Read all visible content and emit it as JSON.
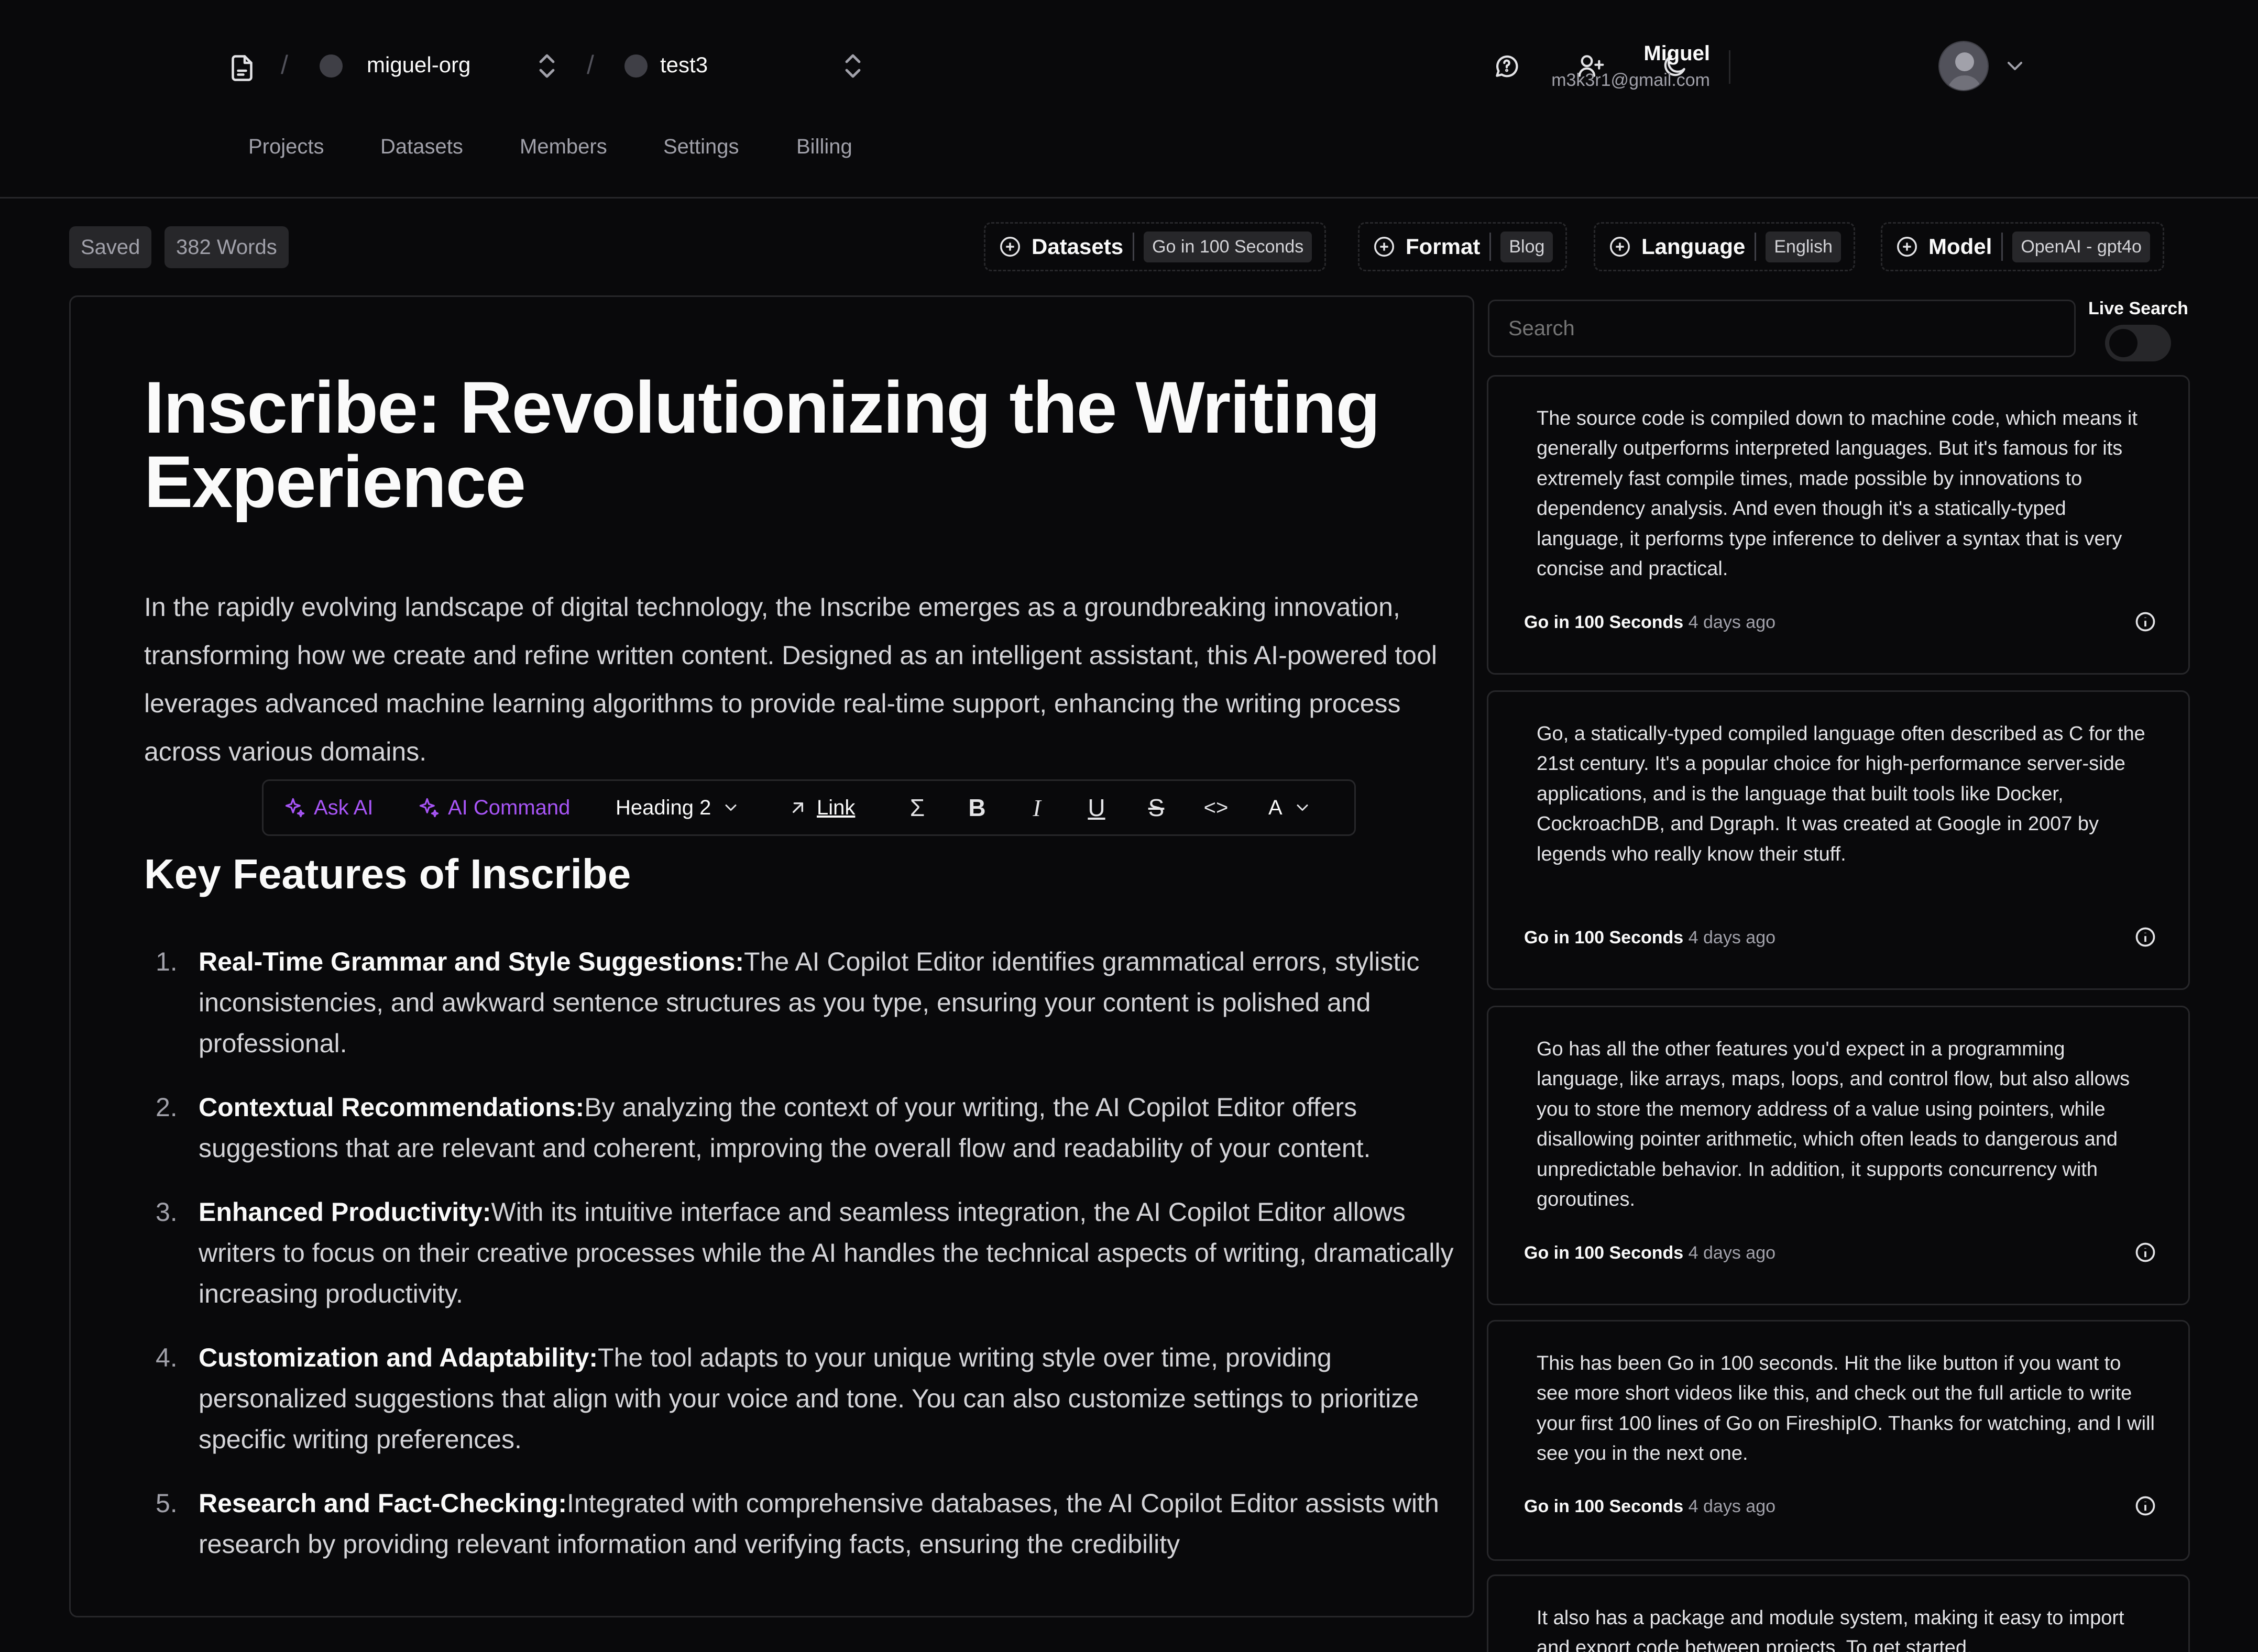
{
  "topbar": {
    "org": "miguel-org",
    "project": "test3",
    "user": {
      "name": "Miguel",
      "email": "m3k3r1@gmail.com"
    }
  },
  "nav": [
    "Projects",
    "Datasets",
    "Members",
    "Settings",
    "Billing"
  ],
  "status": {
    "saved": "Saved",
    "words": "382 Words"
  },
  "options": {
    "datasets": {
      "label": "Datasets",
      "value": "Go in 100 Seconds"
    },
    "format": {
      "label": "Format",
      "value": "Blog"
    },
    "language": {
      "label": "Language",
      "value": "English"
    },
    "model": {
      "label": "Model",
      "value": "OpenAI - gpt4o"
    }
  },
  "document": {
    "title": "Inscribe: Revolutionizing the Writing Experience",
    "intro": "In the rapidly evolving landscape of digital technology, the Inscribe emerges as a groundbreaking innovation, transforming how we create and refine written content. Designed as an intelligent assistant, this AI-powered tool leverages advanced machine learning algorithms to provide real-time support, enhancing the writing process across various domains.",
    "heading": "Key Features of Inscribe",
    "features": [
      {
        "num": "1.",
        "title": "Real-Time Grammar and Style Suggestions:",
        "text": "The AI Copilot Editor identifies grammatical errors, stylistic inconsistencies, and awkward sentence structures as you type, ensuring your content is polished and professional."
      },
      {
        "num": "2.",
        "title": "Contextual Recommendations:",
        "text": "By analyzing the context of your writing, the AI Copilot Editor offers suggestions that are relevant and coherent, improving the overall flow and readability of your content."
      },
      {
        "num": "3.",
        "title": "Enhanced Productivity:",
        "text": "With its intuitive interface and seamless integration, the AI Copilot Editor allows writers to focus on their creative processes while the AI handles the technical aspects of writing, dramatically increasing productivity."
      },
      {
        "num": "4.",
        "title": "Customization and Adaptability:",
        "text": "The tool adapts to your unique writing style over time, providing personalized suggestions that align with your voice and tone. You can also customize settings to prioritize specific writing preferences."
      },
      {
        "num": "5.",
        "title": "Research and Fact-Checking:",
        "text": "Integrated with comprehensive databases, the AI Copilot Editor assists with research by providing relevant information and verifying facts, ensuring the credibility"
      }
    ]
  },
  "format_bar": {
    "ask_ai": "Ask AI",
    "ai_command": "AI Command",
    "block_type": "Heading 2",
    "link": "Link",
    "sigma": "Σ",
    "bold": "B",
    "italic": "I",
    "underline": "U",
    "strike": "S",
    "code": "<>",
    "text_color": "A"
  },
  "sidebar": {
    "search_placeholder": "Search",
    "live_search_label": "Live Search",
    "live_search_on": false,
    "results": [
      {
        "text": "The source code is compiled down to machine code, which means it generally outperforms interpreted languages. But it's famous for its extremely fast compile times, made possible by innovations to dependency analysis. And even though it's a statically-typed language, it performs type inference to deliver a syntax that is very concise and practical.",
        "source": "Go in 100 Seconds",
        "date": "4 days ago"
      },
      {
        "text": "Go, a statically-typed compiled language often described as C for the 21st century. It's a popular choice for high-performance server-side applications, and is the language that built tools like Docker, CockroachDB, and Dgraph. It was created at Google in 2007 by legends who really know their stuff.",
        "source": "Go in 100 Seconds",
        "date": "4 days ago"
      },
      {
        "text": "Go has all the other features you'd expect in a programming language, like arrays, maps, loops, and control flow, but also allows you to store the memory address of a value using pointers, while disallowing pointer arithmetic, which often leads to dangerous and unpredictable behavior. In addition, it supports concurrency with goroutines.",
        "source": "Go in 100 Seconds",
        "date": "4 days ago"
      },
      {
        "text": "This has been Go in 100 seconds. Hit the like button if you want to see more short videos like this, and check out the full article to write your first 100 lines of Go on FireshipIO. Thanks for watching, and I will see you in the next one.",
        "source": "Go in 100 Seconds",
        "date": "4 days ago"
      },
      {
        "text": "It also has a package and module system, making it easy to import and export code between projects. To get started,",
        "source": "",
        "date": ""
      }
    ]
  },
  "colors": {
    "background": "#09090b",
    "border": "#27272a",
    "accent": "#a855f7",
    "muted": "#a1a1aa"
  }
}
